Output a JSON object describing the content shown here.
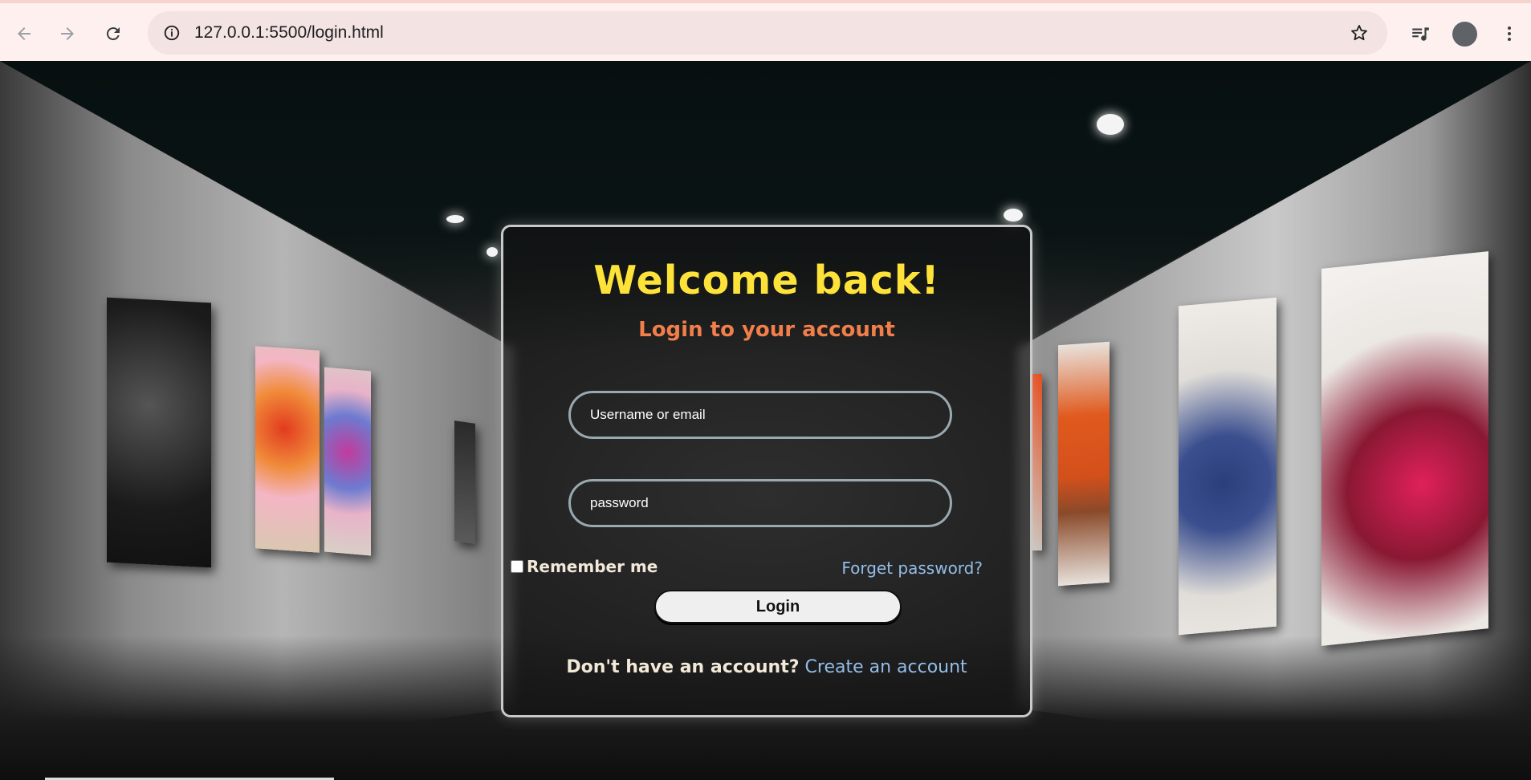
{
  "browser": {
    "url": "127.0.0.1:5500/login.html",
    "icons": {
      "back": "arrow-left-icon",
      "forward": "arrow-right-icon",
      "reload": "reload-icon",
      "site_info": "info-icon",
      "bookmark": "star-icon",
      "media": "media-playlist-icon",
      "profile": "avatar",
      "menu": "kebab-menu-icon"
    }
  },
  "login": {
    "title": "Welcome back!",
    "subtitle": "Login to your account",
    "username_placeholder": "Username or email",
    "password_placeholder": "password",
    "remember_label": "Remember me",
    "remember_checked": false,
    "forgot_label": "Forget password?",
    "login_button": "Login",
    "signup_question": "Don't have an account?",
    "signup_link": "Create an account"
  },
  "colors": {
    "title": "#fde23a",
    "subtitle": "#f27e4a",
    "link": "#93bde8",
    "label": "#f2e9d8"
  }
}
